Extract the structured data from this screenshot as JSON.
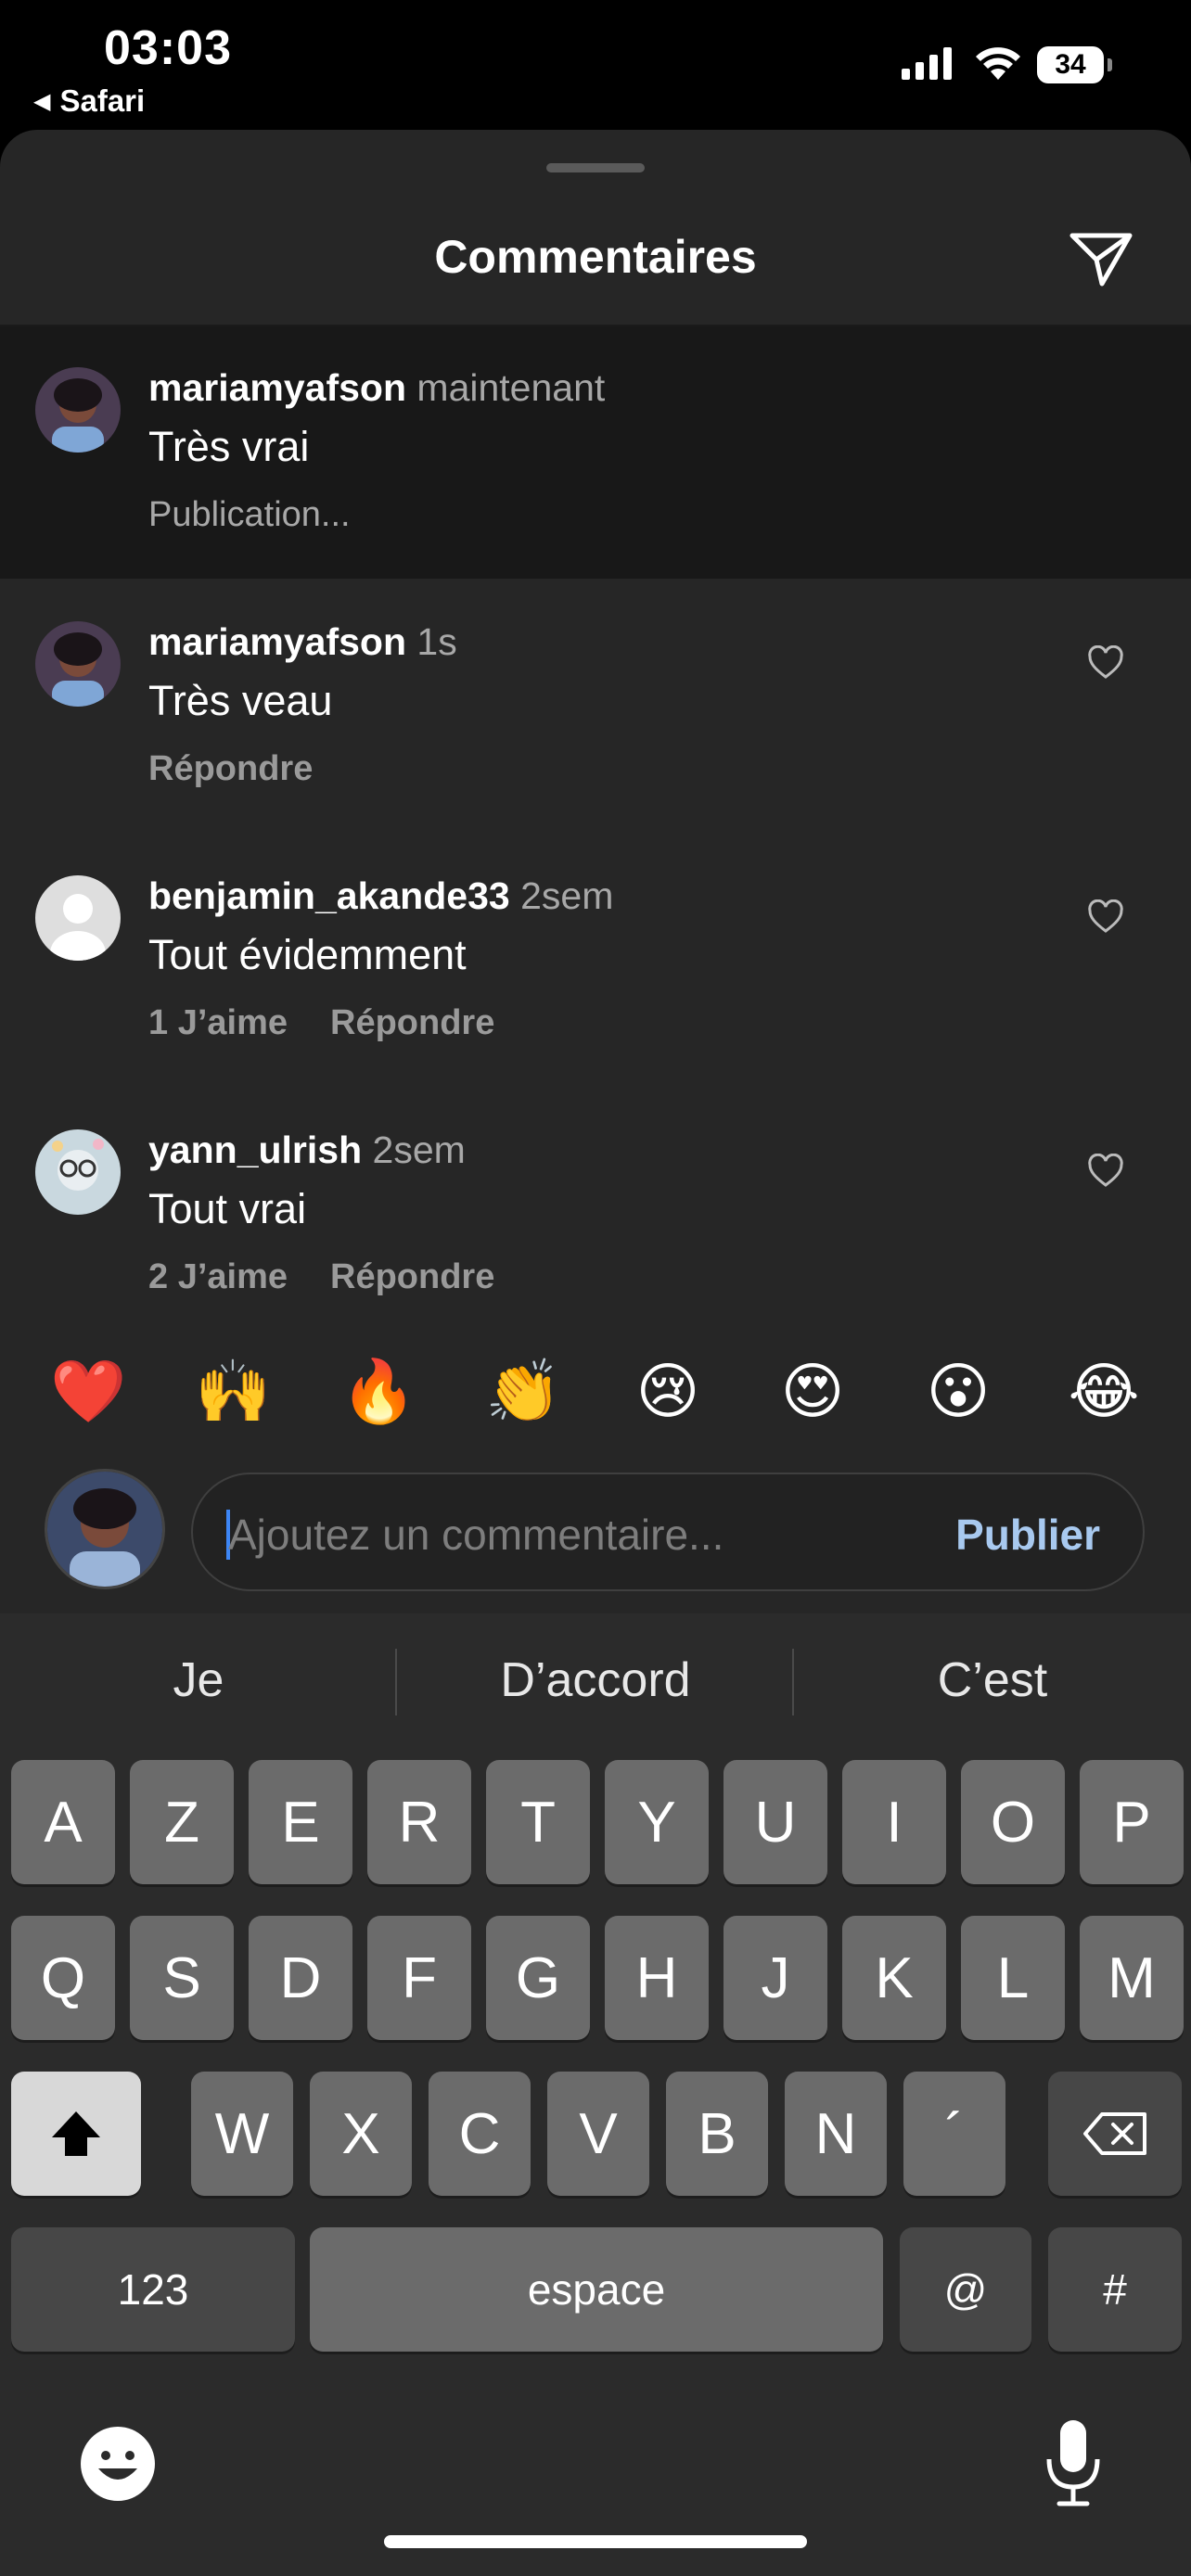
{
  "status_bar": {
    "time": "03:03",
    "back_app": "Safari",
    "battery": "34"
  },
  "sheet": {
    "title": "Commentaires"
  },
  "comments": [
    {
      "username": "mariamyafson",
      "time": "maintenant",
      "text": "Très vrai",
      "status": "Publication..."
    },
    {
      "username": "mariamyafson",
      "time": "1s",
      "text": "Très veau",
      "likes": "",
      "reply": "Répondre"
    },
    {
      "username": "benjamin_akande33",
      "time": "2sem",
      "text": "Tout évidemment",
      "likes": "1 J’aime",
      "reply": "Répondre"
    },
    {
      "username": "yann_ulrish",
      "time": "2sem",
      "text": "Tout vrai",
      "likes": "2 J’aime",
      "reply": "Répondre"
    }
  ],
  "quick_reactions": [
    "❤️",
    "🙌",
    "🔥",
    "👏",
    "😢",
    "😍",
    "😮",
    "😂"
  ],
  "composer": {
    "placeholder": "Ajoutez un commentaire...",
    "publish_label": "Publier"
  },
  "keyboard": {
    "suggestions": [
      "Je",
      "D’accord",
      "C’est"
    ],
    "row1": [
      "A",
      "Z",
      "E",
      "R",
      "T",
      "Y",
      "U",
      "I",
      "O",
      "P"
    ],
    "row2": [
      "Q",
      "S",
      "D",
      "F",
      "G",
      "H",
      "J",
      "K",
      "L",
      "M"
    ],
    "row3": [
      "W",
      "X",
      "C",
      "V",
      "B",
      "N",
      "´"
    ],
    "numbers_label": "123",
    "space_label": "espace",
    "at_label": "@",
    "hash_label": "#"
  },
  "colors": {
    "sheet_bg": "#262626",
    "pending_bg": "#181818",
    "publish": "#a8c9ef",
    "caret": "#3d86f5"
  }
}
